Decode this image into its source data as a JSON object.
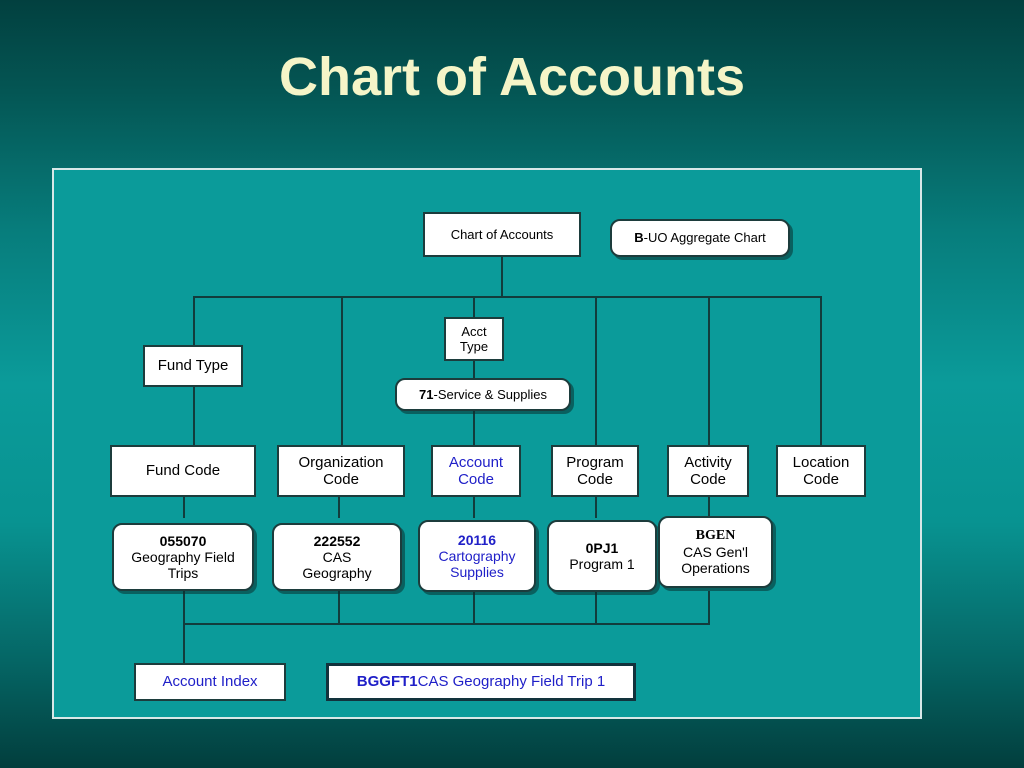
{
  "slide": {
    "title": "Chart of Accounts",
    "title_color": "#f5f5c8",
    "background_color": "#0b9b9a",
    "line_color": "#123c3c",
    "accent_text_color": "#2020c8"
  },
  "nodes": {
    "chart_of_accounts": {
      "label": "Chart of Accounts"
    },
    "uo_aggregate": {
      "code": "B",
      "separator": " - ",
      "label": "UO Aggregate Chart"
    },
    "acct_type": {
      "line1": "Acct",
      "line2": "Type"
    },
    "acct_type_value": {
      "code": "71",
      "separator": " - ",
      "label": "Service & Supplies"
    },
    "fund_type": {
      "label": "Fund Type"
    },
    "fund_code": {
      "line1": "Fund Code",
      "line2": ""
    },
    "organization_code": {
      "line1": "Organization",
      "line2": "Code"
    },
    "account_code": {
      "line1": "Account",
      "line2": "Code"
    },
    "program_code": {
      "line1": "Program",
      "line2": "Code"
    },
    "activity_code": {
      "line1": "Activity",
      "line2": "Code"
    },
    "location_code": {
      "line1": "Location",
      "line2": "Code"
    },
    "fund_code_value": {
      "code": "055070",
      "line1": "Geography Field",
      "line2": "Trips"
    },
    "organization_code_value": {
      "code": "222552",
      "line1": "CAS",
      "line2": "Geography"
    },
    "account_code_value": {
      "code": "20116",
      "line1": "Cartography",
      "line2": "Supplies"
    },
    "program_code_value": {
      "code": "0PJ1",
      "line1": "Program 1",
      "line2": ""
    },
    "activity_code_value": {
      "code": "BGEN",
      "line1": "CAS Gen'l",
      "line2": "Operations"
    },
    "account_index": {
      "label": "Account  Index"
    },
    "account_index_value": {
      "code": "BGGFT1",
      "separator": "  ",
      "label": "CAS Geography Field Trip 1"
    }
  }
}
